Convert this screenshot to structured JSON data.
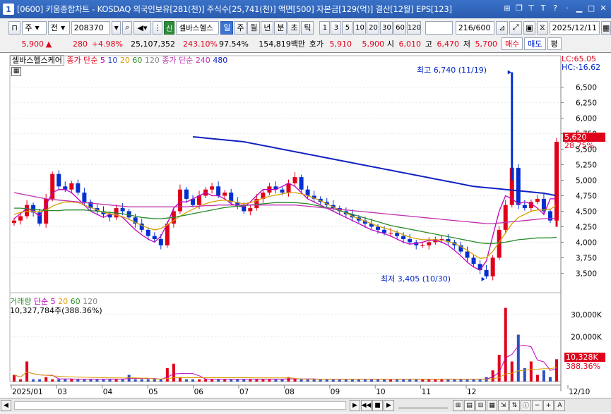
{
  "window": {
    "number": "1",
    "title": "[0600] 키움종합차트 - KOSDAQ 외국인보유[281(천)] 주식수[25,741(천)] 액면[500] 자본금[129(억)] 결산[12월] EPS[123]"
  },
  "toolbar": {
    "type_select": "주",
    "scope_select": "전",
    "code": "208370",
    "badge": "신",
    "stock_name": "셀바스헬스",
    "periods": [
      "일",
      "주",
      "월",
      "년",
      "분",
      "초",
      "틱"
    ],
    "selected_period": "일",
    "intervals": [
      "1",
      "3",
      "5",
      "10",
      "20",
      "30",
      "60",
      "120"
    ],
    "count": "216",
    "total": "/600",
    "date": "2025/12/11"
  },
  "quote": {
    "price": "5,900",
    "arrow": "▲",
    "change": "280",
    "change_pct": "+4.98%",
    "volume": "25,107,352",
    "vol_ratio": "243.10%",
    "strength": "97.54%",
    "amount": "154,819백만",
    "bid_label": "호가",
    "ask": "5,910",
    "bid": "5,900",
    "open_label": "시",
    "open": "6,010",
    "high_label": "고",
    "high": "6,470",
    "low_label": "저",
    "low": "5,700",
    "buy_label": "매수",
    "sell_label": "매도",
    "avg_label": "평"
  },
  "price_panel": {
    "legend_name": "셀바스헬스케어",
    "ma_label_1": "종가 단순",
    "ma_values_1": [
      "5",
      "10",
      "20",
      "60",
      "120"
    ],
    "ma_label_2": "종가 단순",
    "ma_values_2": [
      "240",
      "480"
    ],
    "lc": "LC:65.05",
    "hc": "HC:-16.62",
    "high_annot": "최고 6,740 (11/19)",
    "low_annot": "최저 3,405 (10/30)",
    "last_price": "5,620",
    "last_pct": "28.75%"
  },
  "volume_panel": {
    "legend_label": "거래량",
    "ma_label": "단순",
    "ma_values": [
      "5",
      "20",
      "60",
      "120"
    ],
    "current": "10,327,784주(388.36%)",
    "last_vol": "10,328K",
    "last_pct": "388.36%"
  },
  "x_axis": [
    "2025/01",
    "03",
    "04",
    "05",
    "06",
    "07",
    "08",
    "09",
    "10",
    "11",
    "12",
    "12/10"
  ],
  "chart_data": {
    "type": "candlestick",
    "price_axis_ticks": [
      "6,500",
      "6,250",
      "6,000",
      "5,750",
      "5,500",
      "5,250",
      "5,000",
      "4,750",
      "4,500",
      "4,250",
      "4,000",
      "3,750",
      "3,500"
    ],
    "volume_axis_ticks": [
      "30,000K",
      "20,000K"
    ],
    "ylim": [
      3300,
      6780
    ],
    "series": [
      {
        "name": "종가",
        "color": "#2040c0",
        "values": [
          4350,
          4420,
          4600,
          4480,
          4300,
          4700,
          5100,
          4900,
          4850,
          4950,
          4800,
          4650,
          4550,
          4500,
          4450,
          4400,
          4550,
          4500,
          4400,
          4300,
          4200,
          4100,
          4050,
          3950,
          4300,
          4500,
          4850,
          4700,
          4600,
          4750,
          4850,
          4900,
          4750,
          4800,
          4650,
          4600,
          4500,
          4550,
          4700,
          4800,
          4900,
          4850,
          4800,
          4950,
          5050,
          4850,
          4750,
          4700,
          4650,
          4600,
          4550,
          4500,
          4450,
          4400,
          4350,
          4300,
          4250,
          4200,
          4150,
          4150,
          4100,
          4050,
          4000,
          3950,
          3950,
          4000,
          4050,
          4050,
          4000,
          3950,
          3850,
          3750,
          3650,
          3550,
          3450,
          3750,
          4200,
          4600,
          5200,
          4600,
          4550,
          4650,
          4700,
          4500,
          4350,
          5620
        ]
      },
      {
        "name": "5",
        "color": "#c000c0",
        "values": [
          4380,
          4460,
          4550,
          4500,
          4420,
          4600,
          4800,
          4850,
          4850,
          4800,
          4700,
          4600,
          4500,
          4450,
          4400,
          4450,
          4450,
          4400,
          4300,
          4200,
          4120,
          4050,
          4000,
          4100,
          4300,
          4550,
          4650,
          4650,
          4700,
          4750,
          4800,
          4750,
          4750,
          4700,
          4620,
          4580,
          4570,
          4650,
          4750,
          4850,
          4850,
          4850,
          4900,
          4950,
          4900,
          4800,
          4700,
          4650,
          4600,
          4550,
          4500,
          4450,
          4400,
          4350,
          4300,
          4250,
          4200,
          4170,
          4140,
          4100,
          4050,
          4000,
          3970,
          3980,
          4000,
          4030,
          4030,
          4000,
          3950,
          3870,
          3780,
          3680,
          3600,
          3550,
          3700,
          4100,
          4500,
          4750,
          4700,
          4620,
          4650,
          4620,
          4550,
          4450,
          4700,
          4700
        ]
      },
      {
        "name": "20",
        "color": "#d8a000",
        "values": [
          4450,
          4480,
          4500,
          4500,
          4490,
          4520,
          4580,
          4620,
          4650,
          4650,
          4640,
          4600,
          4560,
          4520,
          4480,
          4460,
          4440,
          4410,
          4370,
          4320,
          4270,
          4230,
          4200,
          4220,
          4280,
          4350,
          4420,
          4480,
          4530,
          4580,
          4620,
          4650,
          4670,
          4680,
          4660,
          4640,
          4620,
          4640,
          4670,
          4710,
          4740,
          4760,
          4780,
          4800,
          4800,
          4780,
          4750,
          4710,
          4670,
          4620,
          4570,
          4520,
          4470,
          4420,
          4380,
          4340,
          4300,
          4260,
          4230,
          4200,
          4160,
          4120,
          4080,
          4060,
          4040,
          4040,
          4040,
          4030,
          4010,
          3980,
          3930,
          3870,
          3800,
          3740,
          3750,
          3850,
          4000,
          4150,
          4300,
          4400,
          4450,
          4500,
          4520,
          4520,
          4530,
          4600
        ]
      },
      {
        "name": "60",
        "color": "#2a8a2a",
        "values": [
          4550,
          4550,
          4540,
          4530,
          4520,
          4510,
          4510,
          4510,
          4520,
          4520,
          4520,
          4520,
          4510,
          4500,
          4490,
          4480,
          4470,
          4460,
          4440,
          4420,
          4400,
          4390,
          4380,
          4380,
          4390,
          4400,
          4420,
          4440,
          4460,
          4480,
          4500,
          4520,
          4540,
          4560,
          4570,
          4580,
          4590,
          4600,
          4610,
          4620,
          4630,
          4640,
          4640,
          4640,
          4640,
          4630,
          4620,
          4600,
          4580,
          4560,
          4540,
          4510,
          4480,
          4450,
          4420,
          4390,
          4360,
          4330,
          4300,
          4270,
          4250,
          4230,
          4210,
          4190,
          4170,
          4150,
          4130,
          4110,
          4090,
          4070,
          4050,
          4030,
          4010,
          3990,
          3980,
          3980,
          3990,
          4000,
          4020,
          4040,
          4050,
          4060,
          4070,
          4070,
          4070,
          4080
        ]
      },
      {
        "name": "120",
        "color": "#c030b0",
        "values": [
          4800,
          4780,
          4760,
          4740,
          4720,
          4700,
          4690,
          4680,
          4670,
          4660,
          4650,
          4640,
          4630,
          4620,
          4610,
          4600,
          4590,
          4580,
          4570,
          4570,
          4570,
          4570,
          4570,
          4570,
          4570,
          4570,
          4570,
          4570,
          4580,
          4580,
          4590,
          4590,
          4600,
          4600,
          4600,
          4600,
          4600,
          4600,
          4600,
          4600,
          4600,
          4600,
          4600,
          4600,
          4600,
          4590,
          4580,
          4570,
          4560,
          4550,
          4540,
          4530,
          4520,
          4510,
          4500,
          4490,
          4480,
          4470,
          4460,
          4450,
          4440,
          4430,
          4420,
          4410,
          4400,
          4390,
          4380,
          4370,
          4360,
          4350,
          4340,
          4330,
          4320,
          4310,
          4300,
          4300,
          4310,
          4320,
          4330,
          4340,
          4350,
          4360,
          4370,
          4380,
          4380,
          4390
        ]
      },
      {
        "name": "240",
        "color": "#1020c0",
        "start": 28,
        "values": [
          5700,
          5690,
          5680,
          5670,
          5660,
          5650,
          5640,
          5630,
          5620,
          5600,
          5580,
          5560,
          5540,
          5520,
          5500,
          5480,
          5460,
          5440,
          5420,
          5400,
          5380,
          5360,
          5340,
          5320,
          5300,
          5280,
          5260,
          5240,
          5220,
          5200,
          5180,
          5160,
          5140,
          5120,
          5100,
          5080,
          5060,
          5040,
          5020,
          5000,
          4980,
          4960,
          4940,
          4920,
          4900,
          4890,
          4880,
          4870,
          4860,
          4850,
          4840,
          4830,
          4820,
          4810,
          4800,
          4790,
          4770,
          4750
        ]
      }
    ],
    "volume": [
      3,
      1,
      9,
      1,
      1,
      2,
      1,
      1,
      1,
      1,
      1,
      1,
      1,
      1,
      1,
      1,
      1,
      1,
      3,
      1,
      1,
      1,
      1,
      1,
      6,
      8,
      2,
      1,
      1,
      1,
      1,
      1,
      1,
      1,
      1,
      1,
      1,
      1,
      1,
      1,
      1,
      1,
      1,
      2,
      1,
      1,
      1,
      1,
      1,
      1,
      1,
      1,
      1,
      1,
      1,
      1,
      1,
      1,
      1,
      1,
      1,
      1,
      1,
      1,
      1,
      1,
      1,
      1,
      1,
      1,
      1,
      1,
      1,
      1,
      2,
      5,
      12,
      33,
      9,
      21,
      6,
      9,
      3,
      5,
      2,
      10
    ]
  },
  "scroll_icons": [
    "◀",
    "◀◀",
    "■",
    "▶",
    "▶",
    "−",
    "+",
    "A"
  ],
  "colors": {
    "up": "#e0001a",
    "down": "#0030d0",
    "title": "#2a5cb0"
  }
}
